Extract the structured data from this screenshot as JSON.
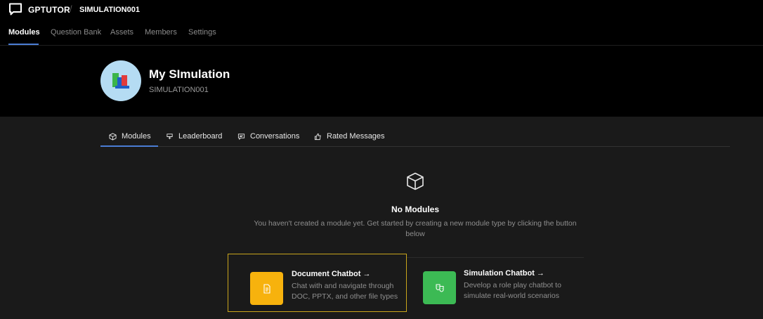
{
  "app": {
    "brand": "GPTUTOR",
    "separator": "/",
    "breadcrumb": "SIMULATION001"
  },
  "top_nav": {
    "tabs": [
      {
        "label": "Modules",
        "active": true
      },
      {
        "label": "Question Bank"
      },
      {
        "label": "Assets"
      },
      {
        "label": "Members"
      },
      {
        "label": "Settings"
      }
    ]
  },
  "project": {
    "title": "My SImulation",
    "code": "SIMULATION001",
    "avatar_icon": "books-icon"
  },
  "sub_tabs": [
    {
      "label": "Modules",
      "icon": "cube-icon",
      "active": true
    },
    {
      "label": "Leaderboard",
      "icon": "trophy-icon"
    },
    {
      "label": "Conversations",
      "icon": "chat-icon"
    },
    {
      "label": "Rated Messages",
      "icon": "thumbs-up-icon"
    }
  ],
  "empty_state": {
    "icon": "cube-icon",
    "title": "No Modules",
    "description_line1": "You haven't created a module yet. Get started by creating a new module type by clicking the button",
    "description_line2": "below"
  },
  "module_types": [
    {
      "title": "Document Chatbot →",
      "desc_line1": "Chat with and navigate through",
      "desc_line2": "DOC, PPTX, and other file types",
      "icon": "document-icon",
      "color": "#f7b20d",
      "selected": true
    },
    {
      "title": "Simulation Chatbot →",
      "desc_line1": "Develop a role play chatbot to",
      "desc_line2": "simulate real-world scenarios",
      "icon": "masks-icon",
      "color": "#3cba54"
    }
  ],
  "colors": {
    "accent": "#4b7dd4",
    "selection_border": "#c9a51c"
  }
}
